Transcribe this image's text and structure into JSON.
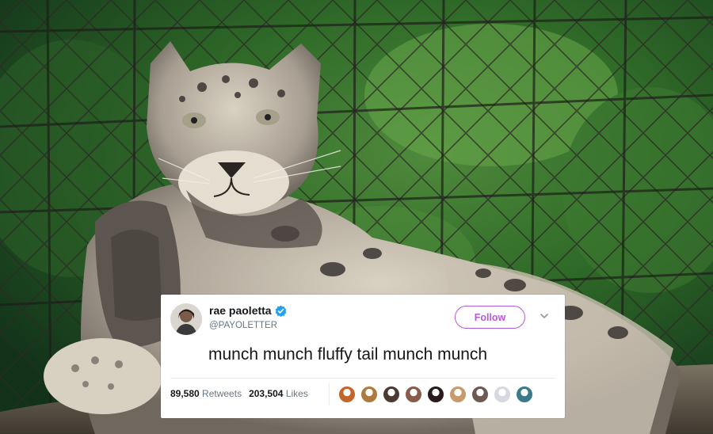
{
  "tweet": {
    "display_name": "rae paoletta",
    "handle": "@PAYOLETTER",
    "follow_label": "Follow",
    "text": "munch munch fluffy tail munch munch",
    "retweets_count": "89,580",
    "retweets_label": "Retweets",
    "likes_count": "203,504",
    "likes_label": "Likes"
  },
  "colors": {
    "follow_accent": "#b55bd8",
    "verified_blue": "#1da1f2",
    "text_primary": "#14171a",
    "text_secondary": "#657786"
  },
  "icons": {
    "verified": "verified-badge-icon",
    "more": "chevron-down-icon"
  },
  "liker_avatar_colors": [
    "#c4652a",
    "#b07a3c",
    "#4a3a32",
    "#8a5a4a",
    "#2a1a1c",
    "#c89a6a",
    "#6e5a50",
    "#d8d8e0",
    "#3a7a8a"
  ]
}
